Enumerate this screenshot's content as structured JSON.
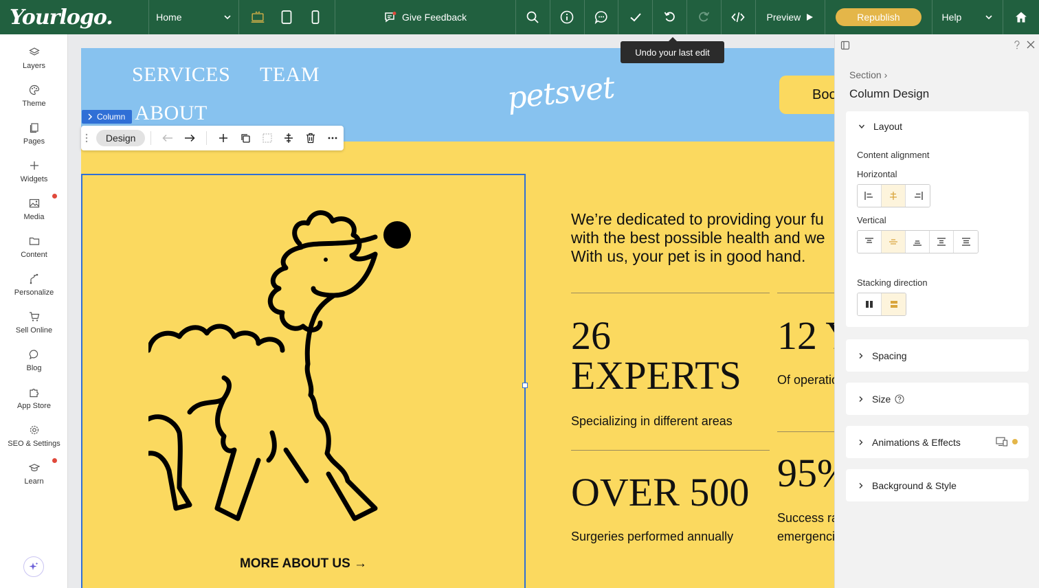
{
  "topbar": {
    "logo": "Yourlogo.",
    "page": "Home",
    "feedback": "Give Feedback",
    "preview": "Preview",
    "republish": "Republish",
    "help": "Help"
  },
  "tooltip": "Undo your last edit",
  "sidebar": {
    "items": [
      {
        "label": "Layers",
        "icon": "layers-icon"
      },
      {
        "label": "Theme",
        "icon": "palette-icon"
      },
      {
        "label": "Pages",
        "icon": "pages-icon"
      },
      {
        "label": "Widgets",
        "icon": "plus-icon"
      },
      {
        "label": "Media",
        "icon": "image-icon"
      },
      {
        "label": "Content",
        "icon": "folder-icon"
      },
      {
        "label": "Personalize",
        "icon": "personalize-icon"
      },
      {
        "label": "Sell Online",
        "icon": "cart-icon"
      },
      {
        "label": "Blog",
        "icon": "chat-icon"
      },
      {
        "label": "App Store",
        "icon": "puzzle-icon"
      },
      {
        "label": "SEO & Settings",
        "icon": "gear-icon"
      },
      {
        "label": "Learn",
        "icon": "graduation-cap-icon"
      }
    ]
  },
  "site": {
    "nav": [
      "SERVICES",
      "TEAM",
      "ABOUT"
    ],
    "brand": "petsvet",
    "book": "Boo",
    "intro": [
      "We’re dedicated to providing your fu",
      "with the best possible health and we",
      "With us, your pet is in good hand."
    ],
    "more": "MORE ABOUT US →",
    "stats": [
      {
        "num": [
          "26",
          "EXPERTS"
        ],
        "desc": [
          "Specializing in different areas"
        ]
      },
      {
        "num": [
          "12 Y"
        ],
        "desc": [
          "Of operatio"
        ]
      },
      {
        "num": [
          "OVER 500"
        ],
        "desc": [
          "Surgeries performed annually"
        ]
      },
      {
        "num": [
          "95%"
        ],
        "desc": [
          "Success ra",
          "emergenci"
        ]
      }
    ]
  },
  "selection": {
    "tag": "Column",
    "design": "Design"
  },
  "panel": {
    "breadcrumb": "Section",
    "title": "Column Design",
    "layout": "Layout",
    "content_alignment": "Content alignment",
    "horizontal": "Horizontal",
    "vertical": "Vertical",
    "stacking": "Stacking direction",
    "sections": [
      "Spacing",
      "Size",
      "Animations & Effects",
      "Background & Style"
    ]
  },
  "colors": {
    "topbar": "#21603f",
    "accent": "#e4b649",
    "header_blue": "#87c2ef",
    "body_yellow": "#fbd95f",
    "selection_blue": "#2f6fd6"
  }
}
